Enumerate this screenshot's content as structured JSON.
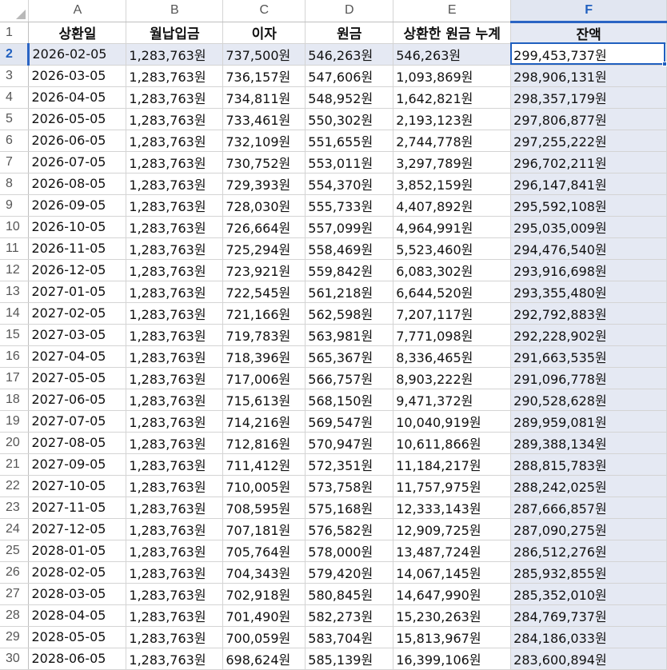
{
  "sheet": {
    "columns": [
      "A",
      "B",
      "C",
      "D",
      "E",
      "F"
    ],
    "selected_column": "F",
    "active_cell": "F2",
    "headers": [
      "상환일",
      "월납입금",
      "이자",
      "원금",
      "상환한 원금 누계",
      "잔액"
    ],
    "rows": [
      [
        "2026-02-05",
        "1,283,763원",
        "737,500원",
        "546,263원",
        "546,263원",
        "299,453,737원"
      ],
      [
        "2026-03-05",
        "1,283,763원",
        "736,157원",
        "547,606원",
        "1,093,869원",
        "298,906,131원"
      ],
      [
        "2026-04-05",
        "1,283,763원",
        "734,811원",
        "548,952원",
        "1,642,821원",
        "298,357,179원"
      ],
      [
        "2026-05-05",
        "1,283,763원",
        "733,461원",
        "550,302원",
        "2,193,123원",
        "297,806,877원"
      ],
      [
        "2026-06-05",
        "1,283,763원",
        "732,109원",
        "551,655원",
        "2,744,778원",
        "297,255,222원"
      ],
      [
        "2026-07-05",
        "1,283,763원",
        "730,752원",
        "553,011원",
        "3,297,789원",
        "296,702,211원"
      ],
      [
        "2026-08-05",
        "1,283,763원",
        "729,393원",
        "554,370원",
        "3,852,159원",
        "296,147,841원"
      ],
      [
        "2026-09-05",
        "1,283,763원",
        "728,030원",
        "555,733원",
        "4,407,892원",
        "295,592,108원"
      ],
      [
        "2026-10-05",
        "1,283,763원",
        "726,664원",
        "557,099원",
        "4,964,991원",
        "295,035,009원"
      ],
      [
        "2026-11-05",
        "1,283,763원",
        "725,294원",
        "558,469원",
        "5,523,460원",
        "294,476,540원"
      ],
      [
        "2026-12-05",
        "1,283,763원",
        "723,921원",
        "559,842원",
        "6,083,302원",
        "293,916,698원"
      ],
      [
        "2027-01-05",
        "1,283,763원",
        "722,545원",
        "561,218원",
        "6,644,520원",
        "293,355,480원"
      ],
      [
        "2027-02-05",
        "1,283,763원",
        "721,166원",
        "562,598원",
        "7,207,117원",
        "292,792,883원"
      ],
      [
        "2027-03-05",
        "1,283,763원",
        "719,783원",
        "563,981원",
        "7,771,098원",
        "292,228,902원"
      ],
      [
        "2027-04-05",
        "1,283,763원",
        "718,396원",
        "565,367원",
        "8,336,465원",
        "291,663,535원"
      ],
      [
        "2027-05-05",
        "1,283,763원",
        "717,006원",
        "566,757원",
        "8,903,222원",
        "291,096,778원"
      ],
      [
        "2027-06-05",
        "1,283,763원",
        "715,613원",
        "568,150원",
        "9,471,372원",
        "290,528,628원"
      ],
      [
        "2027-07-05",
        "1,283,763원",
        "714,216원",
        "569,547원",
        "10,040,919원",
        "289,959,081원"
      ],
      [
        "2027-08-05",
        "1,283,763원",
        "712,816원",
        "570,947원",
        "10,611,866원",
        "289,388,134원"
      ],
      [
        "2027-09-05",
        "1,283,763원",
        "711,412원",
        "572,351원",
        "11,184,217원",
        "288,815,783원"
      ],
      [
        "2027-10-05",
        "1,283,763원",
        "710,005원",
        "573,758원",
        "11,757,975원",
        "288,242,025원"
      ],
      [
        "2027-11-05",
        "1,283,763원",
        "708,595원",
        "575,168원",
        "12,333,143원",
        "287,666,857원"
      ],
      [
        "2027-12-05",
        "1,283,763원",
        "707,181원",
        "576,582원",
        "12,909,725원",
        "287,090,275원"
      ],
      [
        "2028-01-05",
        "1,283,763원",
        "705,764원",
        "578,000원",
        "13,487,724원",
        "286,512,276원"
      ],
      [
        "2028-02-05",
        "1,283,763원",
        "704,343원",
        "579,420원",
        "14,067,145원",
        "285,932,855원"
      ],
      [
        "2028-03-05",
        "1,283,763원",
        "702,918원",
        "580,845원",
        "14,647,990원",
        "285,352,010원"
      ],
      [
        "2028-04-05",
        "1,283,763원",
        "701,490원",
        "582,273원",
        "15,230,263원",
        "284,769,737원"
      ],
      [
        "2028-05-05",
        "1,283,763원",
        "700,059원",
        "583,704원",
        "15,813,967원",
        "284,186,033원"
      ],
      [
        "2028-06-05",
        "1,283,763원",
        "698,624원",
        "585,139원",
        "16,399,106원",
        "283,600,894원"
      ]
    ],
    "colors": {
      "selection_accent": "#1f5fbf",
      "selection_fill": "#e5e9f3",
      "gridline": "#d4d4d4"
    }
  }
}
